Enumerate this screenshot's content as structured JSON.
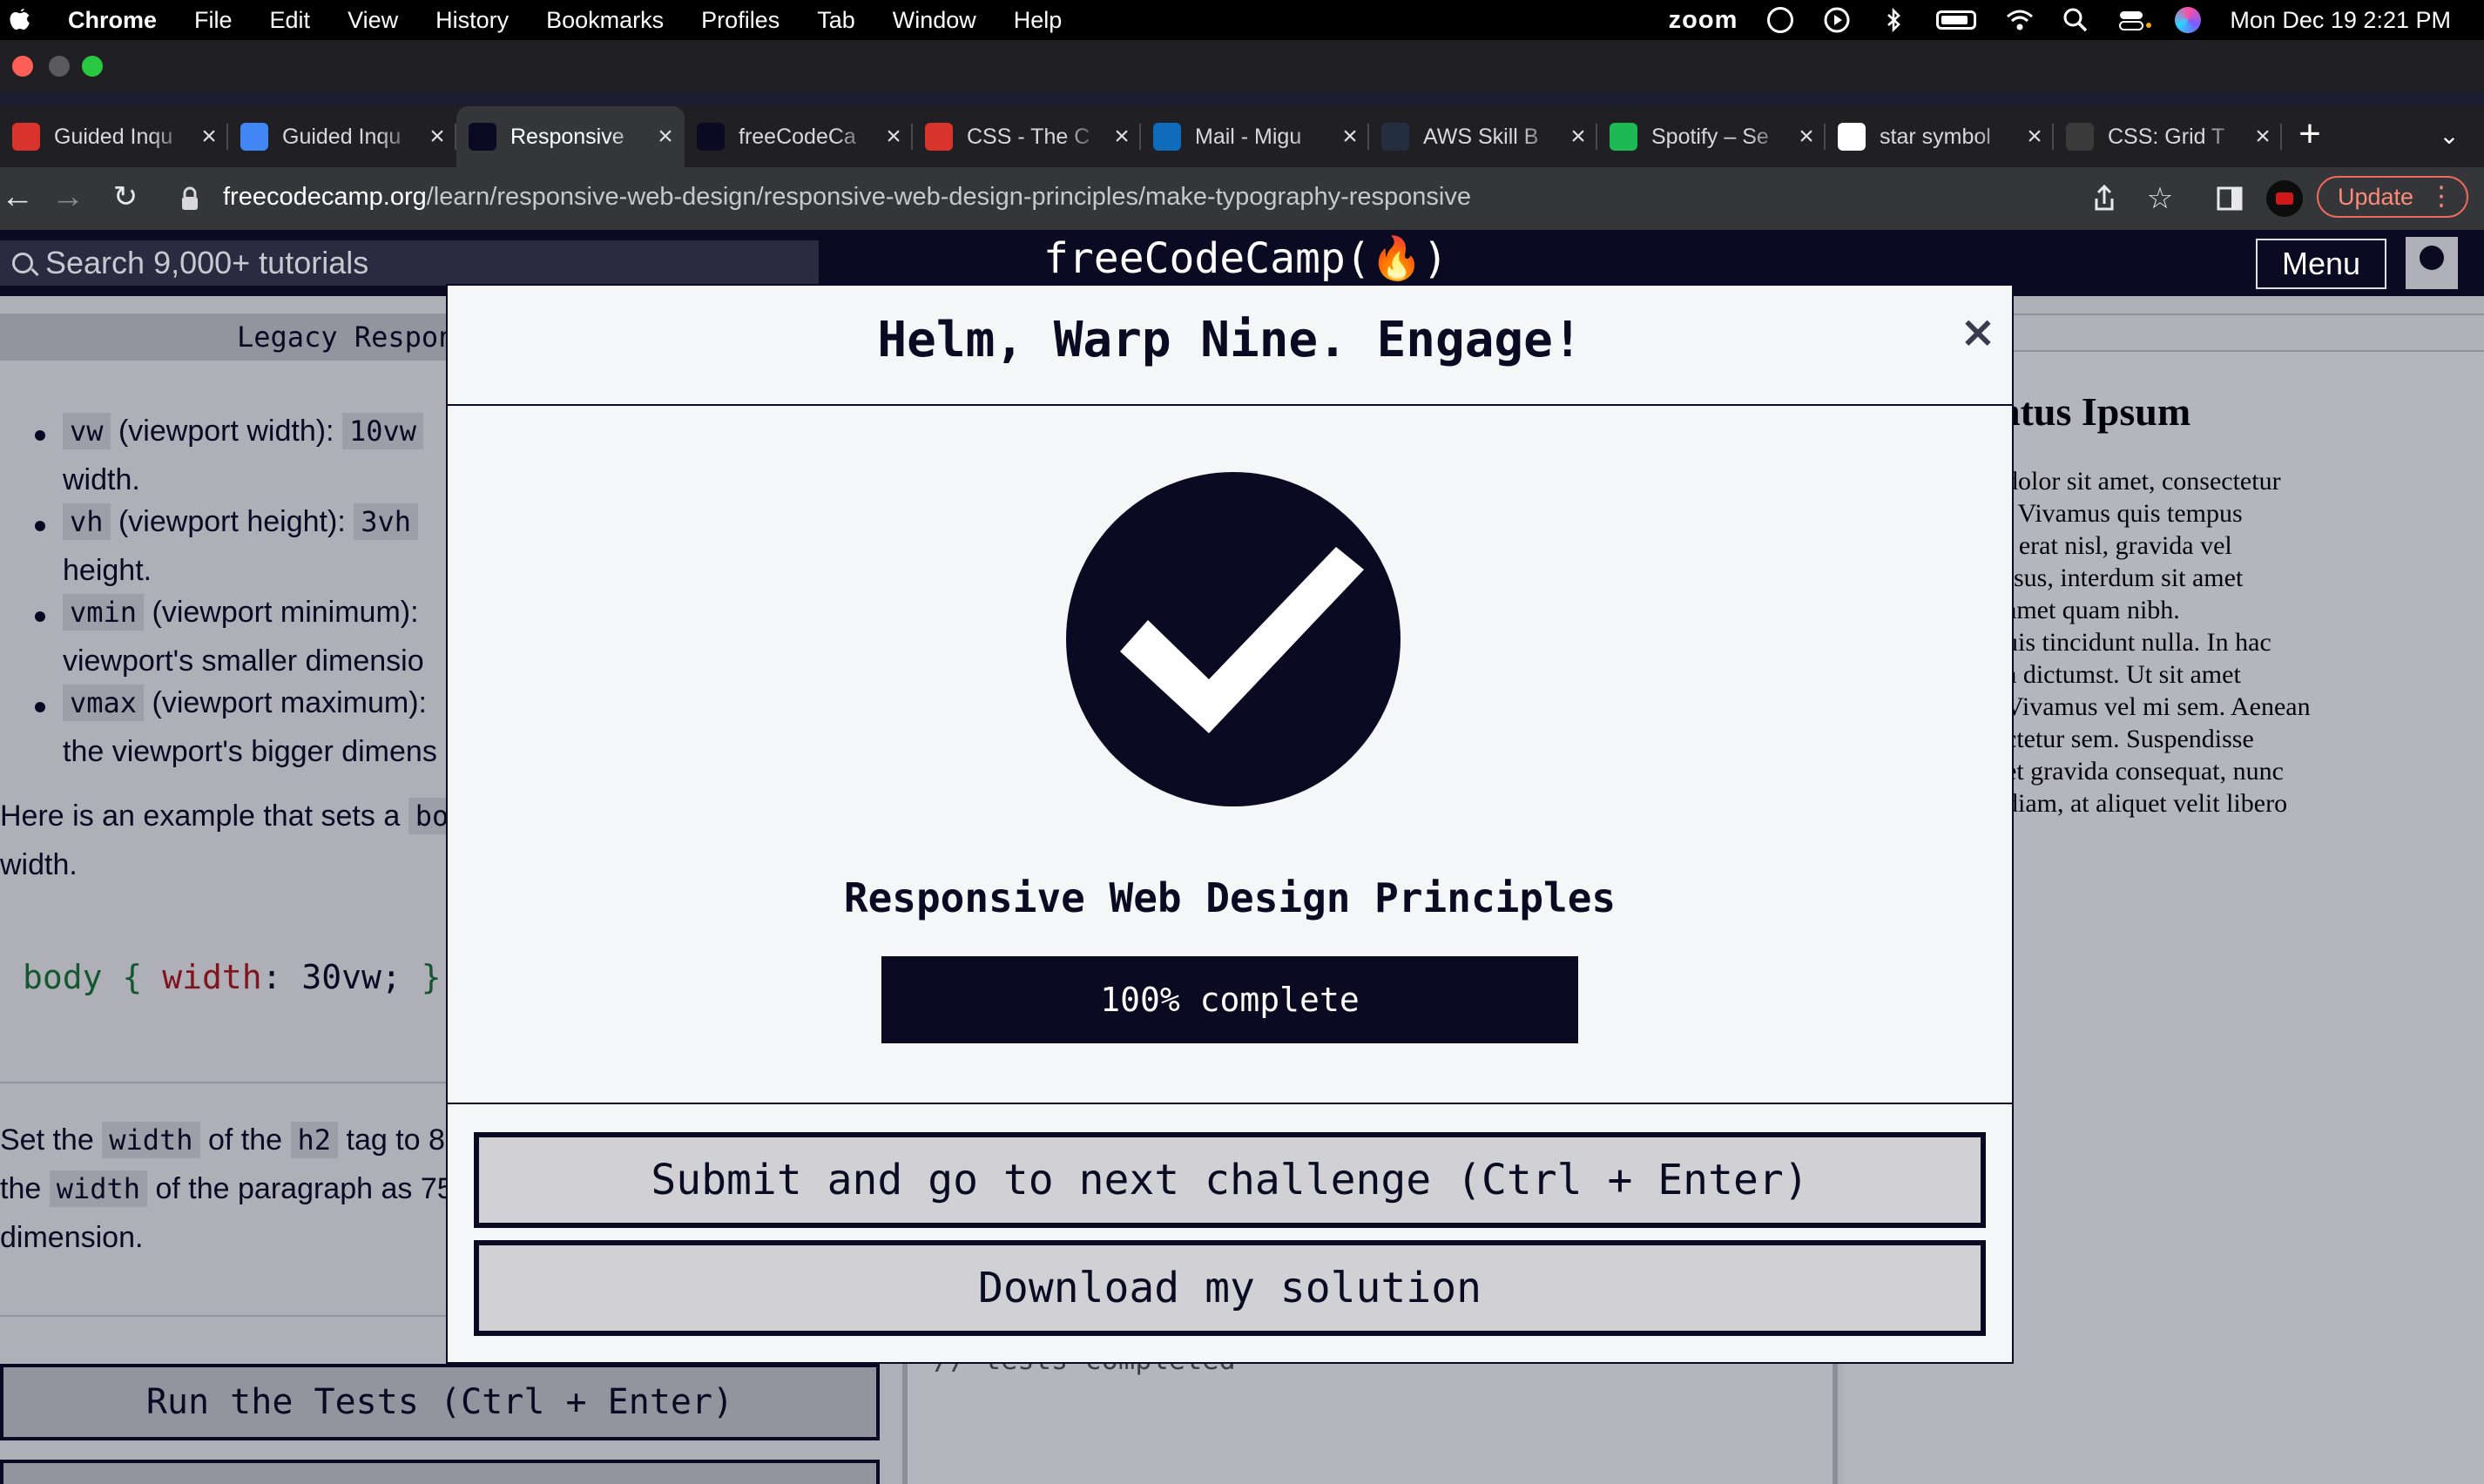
{
  "menubar": {
    "app": "Chrome",
    "items": [
      "File",
      "Edit",
      "View",
      "History",
      "Bookmarks",
      "Profiles",
      "Tab",
      "Window",
      "Help"
    ],
    "zoom": "zoom",
    "clock": "Mon Dec 19  2:21 PM"
  },
  "tabs": [
    {
      "title": "Guided Inqu",
      "favicon_color": "#d9342b",
      "active": false
    },
    {
      "title": "Guided Inqu",
      "favicon_color": "#4285f4",
      "active": false
    },
    {
      "title": "Responsive",
      "favicon_color": "#0a0a23",
      "active": true
    },
    {
      "title": "freeCodeCa",
      "favicon_color": "#0a0a23",
      "active": false
    },
    {
      "title": "CSS - The C",
      "favicon_color": "#d9342b",
      "active": false
    },
    {
      "title": "Mail - Migu",
      "favicon_color": "#0f6cbd",
      "active": false
    },
    {
      "title": "AWS Skill B",
      "favicon_color": "#232f3e",
      "active": false
    },
    {
      "title": "Spotify – Se",
      "favicon_color": "#1db954",
      "active": false
    },
    {
      "title": "star symbol",
      "favicon_color": "#ffffff",
      "active": false
    },
    {
      "title": "CSS: Grid T",
      "favicon_color": "#3a3a3a",
      "active": false
    }
  ],
  "address": {
    "host": "freecodecamp.org",
    "path": "/learn/responsive-web-design/responsive-web-design-principles/make-typography-responsive",
    "update_label": "Update"
  },
  "fcc": {
    "search_placeholder": "Search 9,000+ tutorials",
    "logo": "freeCodeCamp(🔥)",
    "menu_label": "Menu",
    "left_header": "Legacy Respon"
  },
  "instructions": {
    "li1_code": "vw",
    "li1_text": "(viewport width):",
    "li1_val": "10vw",
    "li1_cont": "width.",
    "li2_code": "vh",
    "li2_text": "(viewport height):",
    "li2_val": "3vh",
    "li2_cont": "height.",
    "li3_code": "vmin",
    "li3_text": "(viewport minimum):",
    "li3_cont": "viewport's smaller dimensio",
    "li4_code": "vmax",
    "li4_text": "(viewport maximum):",
    "li4_cont": "the viewport's bigger dimens",
    "example_a": "Here is an example that sets a",
    "example_code": "bo",
    "example_b": "width.",
    "code_selector": "body",
    "code_open": "{",
    "code_prop": "width",
    "code_value": ": 30vw;",
    "code_close": "}",
    "task_a": "Set the",
    "task_code1": "width",
    "task_b": "of the",
    "task_code2": "h2",
    "task_c": "tag to 8",
    "task_d": "the",
    "task_code3": "width",
    "task_e": "of the paragraph as 75",
    "task_f": "dimension.",
    "run_button": "Run the Tests (Ctrl + Enter)"
  },
  "editor": {
    "console_text": "// tests completed"
  },
  "preview": {
    "heading": "ntus Ipsum",
    "lines": [
      "dolor sit amet, consectetur",
      ". Vivamus quis tempus",
      "i erat nisl, gravida vel",
      "rsus, interdum sit amet",
      "amet quam nibh.",
      "uis tincidunt nulla. In hac",
      "a dictumst. Ut sit amet",
      "Vivamus vel mi sem. Aenean",
      "ctetur sem. Suspendisse",
      " et gravida consequat, nunc",
      " diam, at aliquet velit libero"
    ]
  },
  "modal": {
    "title": "Helm, Warp Nine. Engage!",
    "close": "×",
    "block_name": "Responsive Web Design Principles",
    "progress_percent": 100,
    "progress_text": "100% complete",
    "submit_button": "Submit and go to next challenge (Ctrl + Enter)",
    "download_button": "Download my solution"
  },
  "colors": {
    "fcc_dark": "#0a0a23",
    "fcc_gray": "#d0d0d5",
    "fcc_light": "#f5f6f7"
  }
}
